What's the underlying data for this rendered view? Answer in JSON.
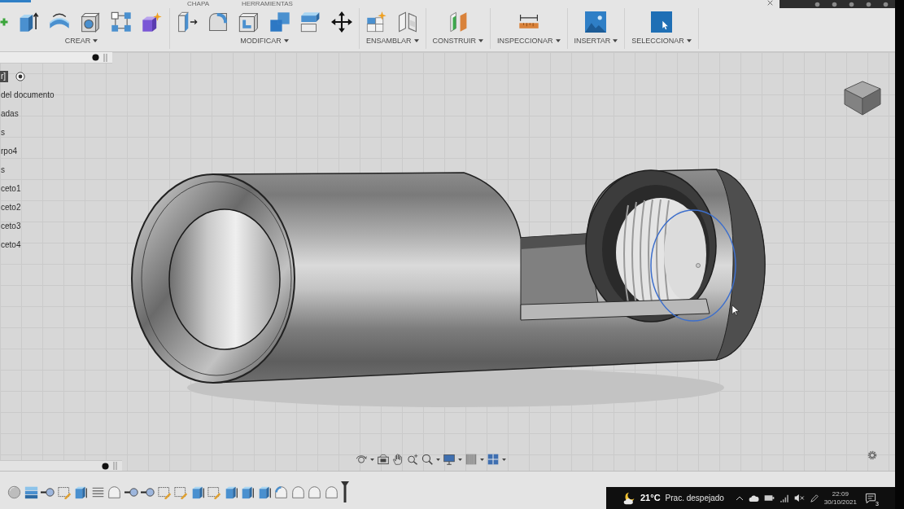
{
  "toolbar": {
    "tabs": [
      {
        "label": "CHAPA"
      },
      {
        "label": "HERRAMIENTAS"
      }
    ],
    "groups": [
      {
        "label": "CREAR"
      },
      {
        "label": "MODIFICAR"
      },
      {
        "label": "ENSAMBLAR"
      },
      {
        "label": "CONSTRUIR"
      },
      {
        "label": "INSPECCIONAR"
      },
      {
        "label": "INSERTAR"
      },
      {
        "label": "SELECCIONAR"
      }
    ]
  },
  "browser": {
    "items": [
      {
        "label": "r]",
        "kind": "component",
        "selected": true
      },
      {
        "label": "del documento",
        "kind": "entry",
        "selected": false
      },
      {
        "label": "adas",
        "kind": "entry",
        "selected": false
      },
      {
        "label": "s",
        "kind": "entry",
        "selected": false
      },
      {
        "label": "rpo4",
        "kind": "entry",
        "selected": false
      },
      {
        "label": "s",
        "kind": "entry",
        "selected": false
      },
      {
        "label": "ceto1",
        "kind": "entry",
        "selected": false
      },
      {
        "label": "ceto2",
        "kind": "entry",
        "selected": false
      },
      {
        "label": "ceto3",
        "kind": "entry",
        "selected": false
      },
      {
        "label": "ceto4",
        "kind": "entry",
        "selected": false
      }
    ]
  },
  "taskbar": {
    "weather": {
      "temperature": "21°C",
      "condition": "Prac. despejado"
    },
    "clock": {
      "time": "22:09",
      "date": "30/10/2021"
    },
    "notifications": {
      "count": "3"
    }
  }
}
